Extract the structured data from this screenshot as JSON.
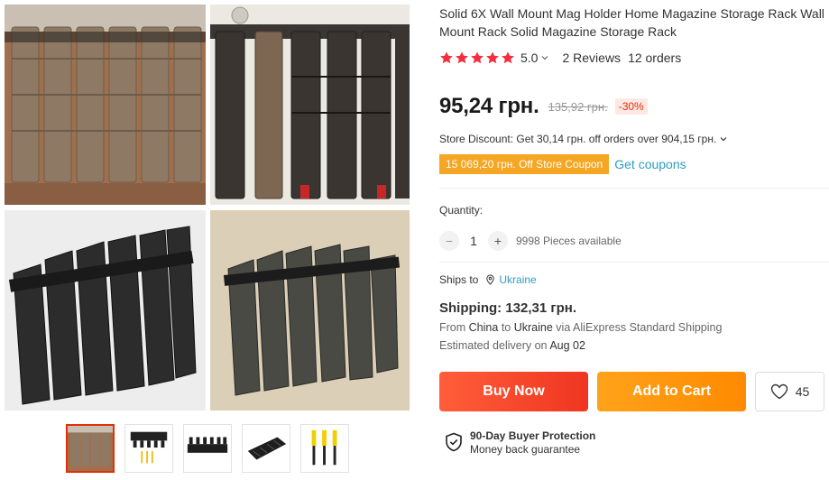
{
  "product": {
    "title": "Solid 6X Wall Mount Mag Holder Home Magazine Storage Rack Wall Mount Rack Solid Magazine Storage Rack",
    "rating": "5.0",
    "reviews": "2 Reviews",
    "orders": "12 orders",
    "stars_filled": 5
  },
  "price": {
    "current": "95,24 грн.",
    "original": "135,92 грн.",
    "discount": "-30%"
  },
  "store_discount": {
    "text": "Store Discount: Get 30,14 грн. off orders over 904,15 грн."
  },
  "coupon": {
    "badge": "15 069,20 грн. Off Store Coupon",
    "link": "Get coupons"
  },
  "quantity": {
    "label": "Quantity:",
    "minus": "−",
    "value": "1",
    "plus": "+",
    "available": "9998 Pieces available"
  },
  "ships_to": {
    "label": "Ships to",
    "country": "Ukraine"
  },
  "shipping": {
    "title": "Shipping: 132,31 грн.",
    "from_word": "From",
    "from": "China",
    "to_word": "to",
    "to": "Ukraine",
    "via": "via AliExpress Standard Shipping",
    "est_label": "Estimated delivery on",
    "est_date": "Aug 02"
  },
  "actions": {
    "buy_now": "Buy Now",
    "add_to_cart": "Add to Cart",
    "wishlist_count": "45"
  },
  "protection": {
    "title": "90-Day Buyer Protection",
    "subtitle": "Money back guarantee"
  },
  "colors": {
    "accent_red": "#e62e04",
    "buy_now": "#f3431f",
    "add_to_cart": "#ff9a0d",
    "link_blue": "#2e9cc3",
    "star": "#f52d3e",
    "coupon": "#f5a623"
  }
}
